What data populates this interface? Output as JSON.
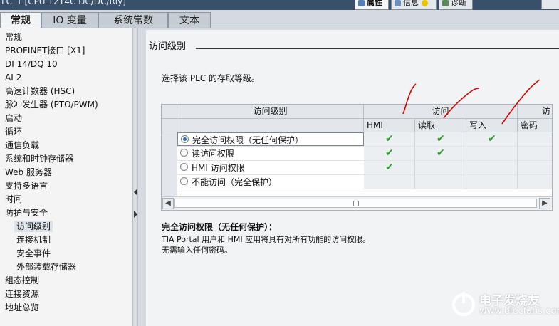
{
  "window": {
    "title_fragment": "LC_1 [CPU 1214C DC/DC/Rly]"
  },
  "inspector_tabs": [
    {
      "label": "属性",
      "active": true
    },
    {
      "label": "信息",
      "active": false
    },
    {
      "label": "诊断",
      "active": false
    }
  ],
  "main_tabs": [
    {
      "label": "常规",
      "active": true
    },
    {
      "label": "IO 变量",
      "active": false
    },
    {
      "label": "系统常数",
      "active": false
    },
    {
      "label": "文本",
      "active": false
    }
  ],
  "nav": {
    "items": [
      {
        "label": "常规",
        "level": 1
      },
      {
        "label": "PROFINET接口 [X1]",
        "level": 1
      },
      {
        "label": "DI 14/DQ 10",
        "level": 1
      },
      {
        "label": "AI 2",
        "level": 1
      },
      {
        "label": "高速计数器 (HSC)",
        "level": 1
      },
      {
        "label": "脉冲发生器 (PTO/PWM)",
        "level": 1
      },
      {
        "label": "启动",
        "level": 1
      },
      {
        "label": "循环",
        "level": 1
      },
      {
        "label": "通信负载",
        "level": 1
      },
      {
        "label": "系统和时钟存储器",
        "level": 1
      },
      {
        "label": "Web 服务器",
        "level": 1
      },
      {
        "label": "支持多语言",
        "level": 1
      },
      {
        "label": "时间",
        "level": 1
      },
      {
        "label": "防护与安全",
        "level": 1
      },
      {
        "label": "访问级别",
        "level": 2,
        "selected": true
      },
      {
        "label": "连接机制",
        "level": 2
      },
      {
        "label": "安全事件",
        "level": 2
      },
      {
        "label": "外部装载存储器",
        "level": 2
      },
      {
        "label": "组态控制",
        "level": 1
      },
      {
        "label": "连接资源",
        "level": 1
      },
      {
        "label": "地址总览",
        "level": 1
      }
    ]
  },
  "content": {
    "section_title": "访问级别",
    "intro": "选择该 PLC 的存取等级。",
    "table": {
      "header_level": "访问级别",
      "header_access": "访问",
      "header_extra": "访",
      "subheaders": [
        "HMI",
        "读取",
        "写入",
        "密码"
      ],
      "rows": [
        {
          "label": "完全访问权限（无任何保护）",
          "selected": true,
          "hmi": true,
          "read": true,
          "write": true
        },
        {
          "label": "读访问权限",
          "selected": false,
          "hmi": true,
          "read": true,
          "write": false
        },
        {
          "label": "HMI 访问权限",
          "selected": false,
          "hmi": true,
          "read": false,
          "write": false
        },
        {
          "label": "不能访问（完全保护）",
          "selected": false,
          "hmi": false,
          "read": false,
          "write": false
        }
      ]
    },
    "description": {
      "title": "完全访问权限（无任何保护）：",
      "lines": [
        "TIA Portal 用户和 HMI 应用将具有对所有功能的访问权限。",
        "无需输入任何密码。"
      ]
    }
  },
  "watermark": {
    "cn": "电子发烧友",
    "en": "www.elecfans.com"
  },
  "colors": {
    "check": "#2f9a2f",
    "annotation": "#e00000",
    "radio_on": "#1f6dc4"
  }
}
